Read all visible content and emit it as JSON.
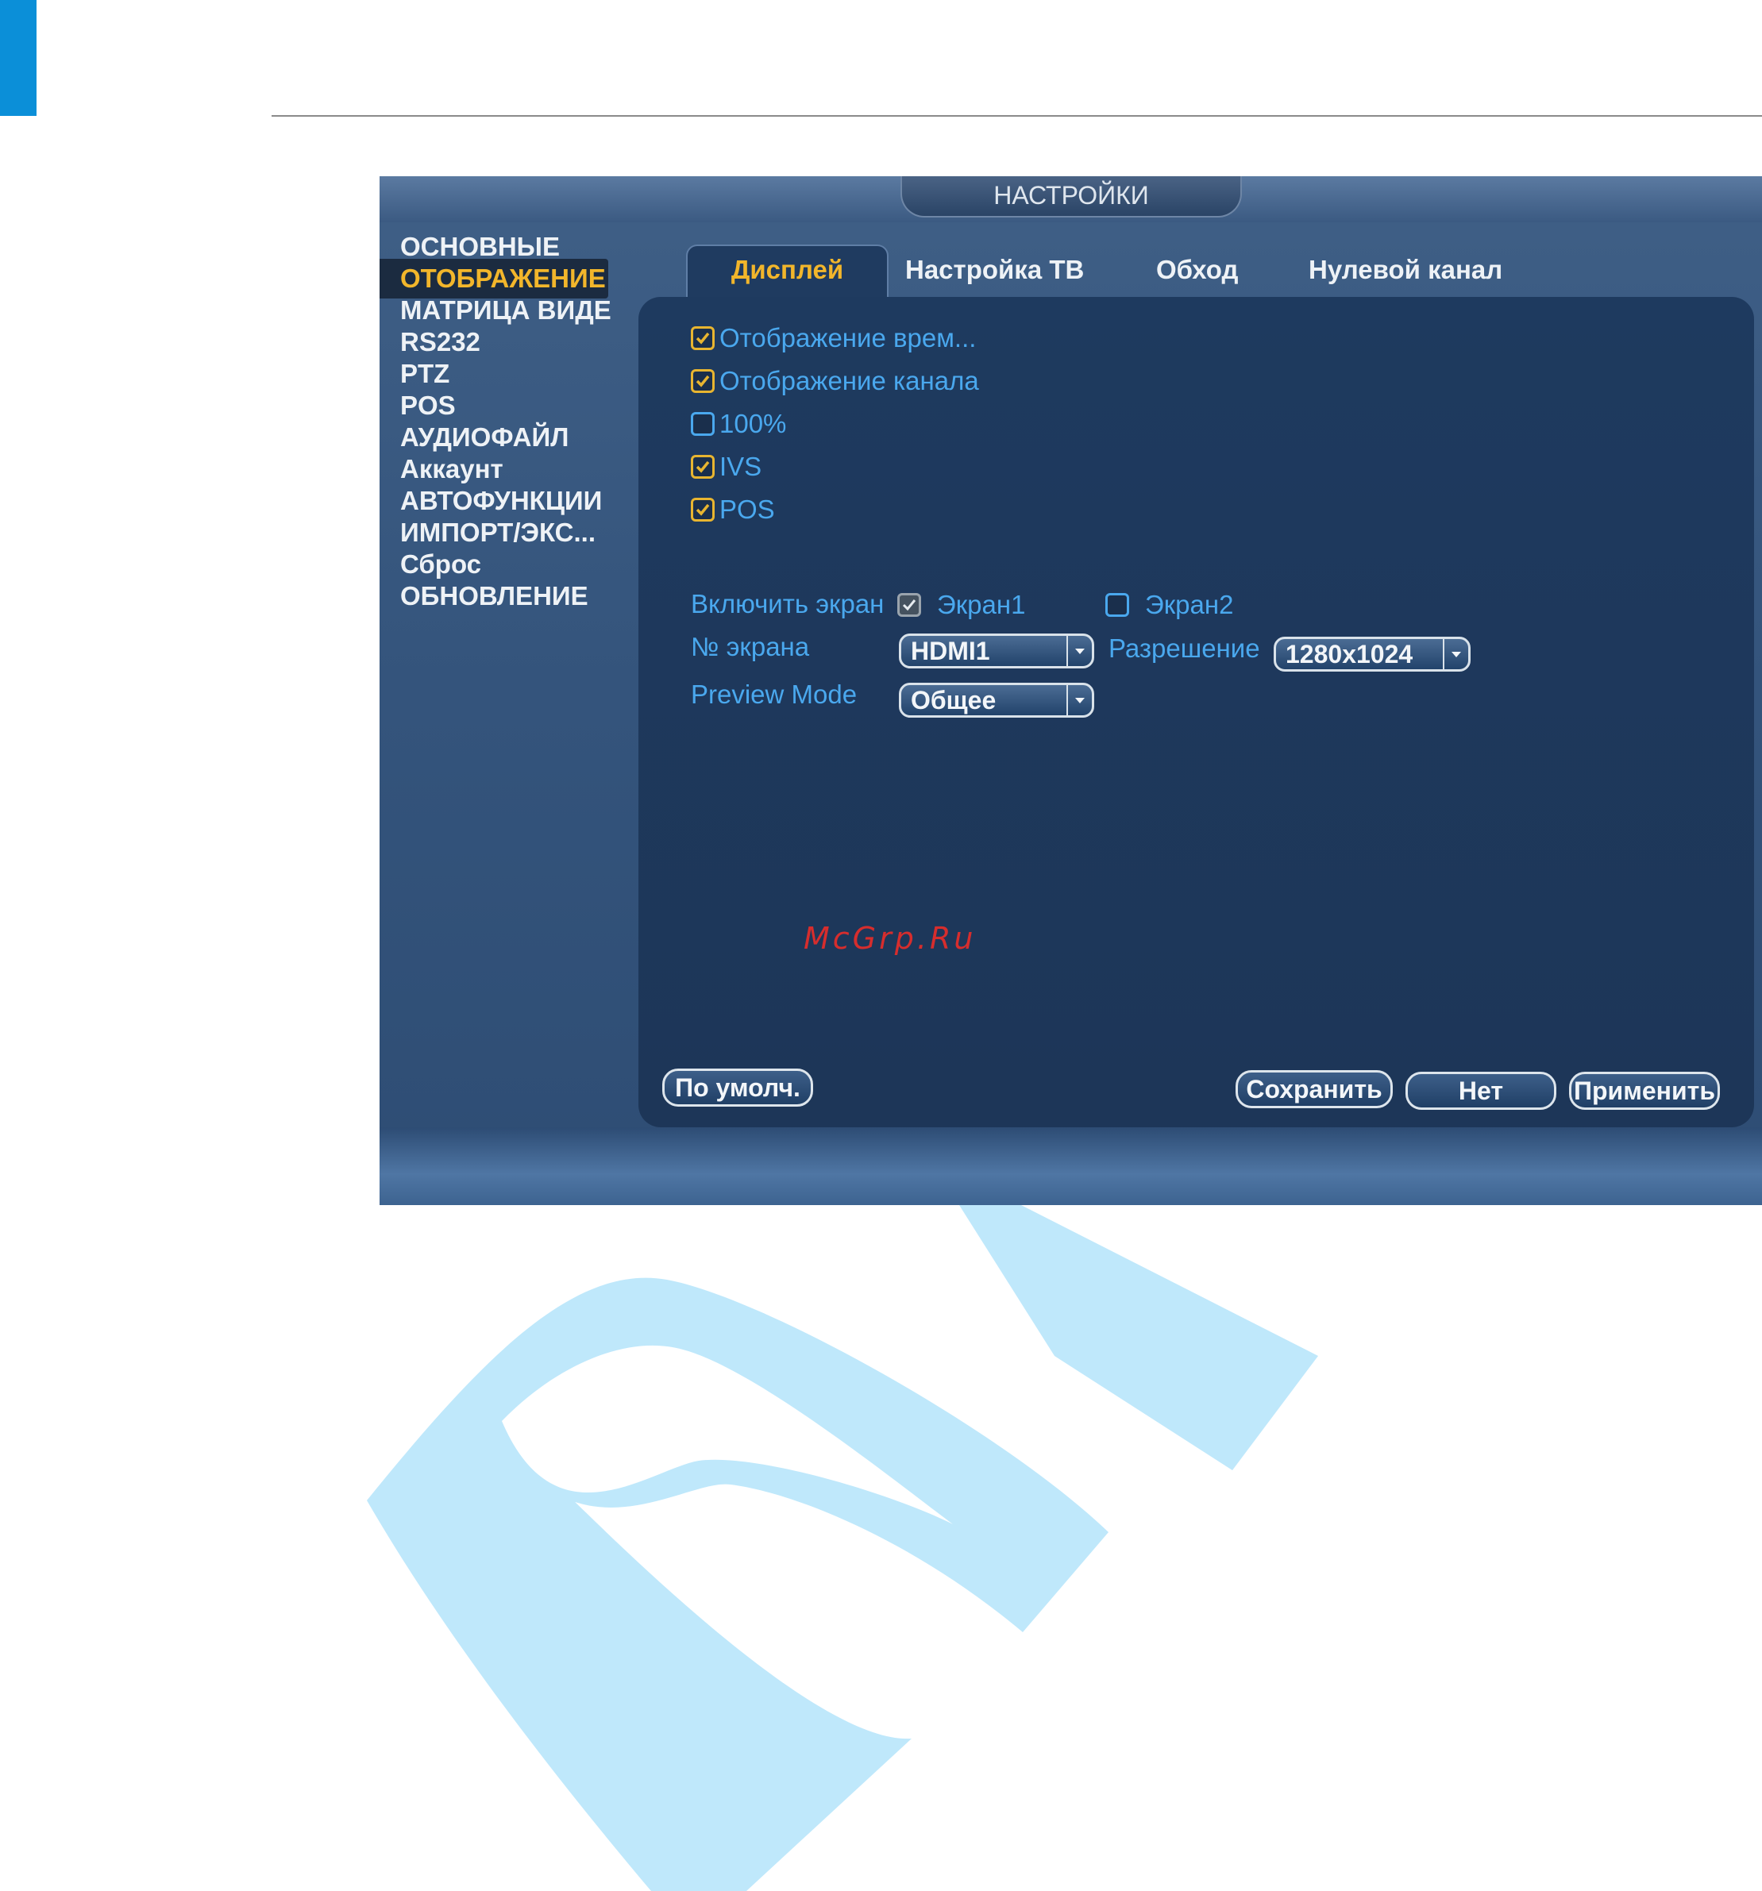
{
  "dialog": {
    "title": "НАСТРОЙКИ",
    "sidebar": [
      "ОСНОВНЫЕ",
      "ОТОБРАЖЕНИЕ",
      "МАТРИЦА ВИДЕ",
      "RS232",
      "PTZ",
      "POS",
      "АУДИОФАЙЛ",
      "Аккаунт",
      "АВТОФУНКЦИИ",
      "ИМПОРТ/ЭКС...",
      "Сброс",
      "ОБНОВЛЕНИЕ"
    ],
    "active_sidebar": "ОТОБРАЖЕНИЕ",
    "tabs": [
      "Дисплей",
      "Настройка ТВ",
      "Обход",
      "Нулевой канал"
    ],
    "active_tab": "Дисплей",
    "checkboxes": [
      {
        "label": "Отображение врем...",
        "checked": true
      },
      {
        "label": "Отображение канала",
        "checked": true
      },
      {
        "label": "100%",
        "checked": false
      },
      {
        "label": "IVS",
        "checked": true
      },
      {
        "label": "POS",
        "checked": true
      }
    ],
    "enable_screen": {
      "label": "Включить экран",
      "screen1": "Экран1",
      "screen1_checked": true,
      "screen2": "Экран2",
      "screen2_checked": false
    },
    "screen_no": {
      "label": "№ экрана",
      "value": "HDMI1"
    },
    "resolution": {
      "label": "Разрешение",
      "value": "1280x1024"
    },
    "preview_mode": {
      "label": "Preview Mode",
      "value": "Общее"
    },
    "buttons": {
      "default": "По умолч.",
      "save": "Сохранить",
      "cancel": "Нет",
      "apply": "Применить"
    }
  },
  "watermark": "McGrp.Ru",
  "colors": {
    "accent": "#f2b62b",
    "label": "#4aa8ee",
    "corner_bar": "#0b8fd8",
    "watermark_r": "#bfe8fb"
  }
}
